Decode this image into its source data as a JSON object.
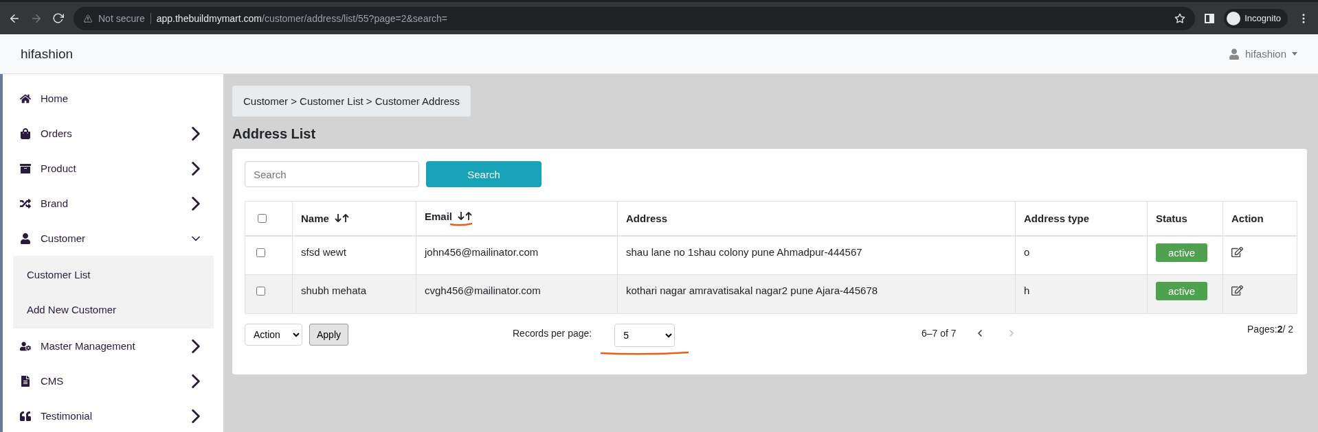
{
  "browser": {
    "security": "Not secure",
    "url_host": "app.thebuildmymart.com",
    "url_path": "/customer/address/list/55?page=2&search=",
    "profile": "Incognito"
  },
  "navbar": {
    "brand": "hifashion",
    "user": "hifashion"
  },
  "sidebar": {
    "items": [
      {
        "label": "Home",
        "kind": "link"
      },
      {
        "label": "Orders",
        "kind": "menu",
        "expanded": false
      },
      {
        "label": "Product",
        "kind": "menu",
        "expanded": false
      },
      {
        "label": "Brand",
        "kind": "menu",
        "expanded": false
      },
      {
        "label": "Customer",
        "kind": "menu",
        "expanded": true,
        "children": [
          {
            "label": "Customer List"
          },
          {
            "label": "Add New Customer"
          }
        ]
      },
      {
        "label": "Master Management",
        "kind": "menu",
        "expanded": false
      },
      {
        "label": "CMS",
        "kind": "menu",
        "expanded": false
      },
      {
        "label": "Testimonial",
        "kind": "menu",
        "expanded": false
      }
    ]
  },
  "breadcrumb": "Customer > Customer List > Customer Address",
  "page_title": "Address List",
  "search": {
    "placeholder": "Search",
    "button": "Search"
  },
  "table": {
    "columns": [
      {
        "kind": "checkbox"
      },
      {
        "label": "Name",
        "kind": "text",
        "sortable": true
      },
      {
        "label": "Email",
        "kind": "text",
        "sortable": true
      },
      {
        "label": "Address",
        "kind": "text",
        "sortable": false
      },
      {
        "label": "Address type",
        "kind": "text",
        "sortable": false
      },
      {
        "label": "Status",
        "kind": "text",
        "sortable": false
      },
      {
        "label": "Action",
        "kind": "text",
        "sortable": false
      }
    ],
    "header_checked": false,
    "rows": [
      {
        "checked": false,
        "name": "sfsd wewt",
        "email": "john456@mailinator.com",
        "address": "shau lane no 1shau colony pune Ahmadpur-444567",
        "address_type": "o",
        "status": "active"
      },
      {
        "checked": false,
        "name": "shubh mehata",
        "email": "cvgh456@mailinator.com",
        "address": "kothari nagar amravatisakal nagar2 pune Ajara-445678",
        "address_type": "h",
        "status": "active"
      }
    ]
  },
  "footer": {
    "bulk_action": "Action",
    "apply": "Apply",
    "records_label": "Records per page:",
    "records_value": "5",
    "range": "6–7 of 7",
    "prev_disabled": false,
    "next_disabled": true,
    "pages": "Pages:**2**/ 2"
  }
}
